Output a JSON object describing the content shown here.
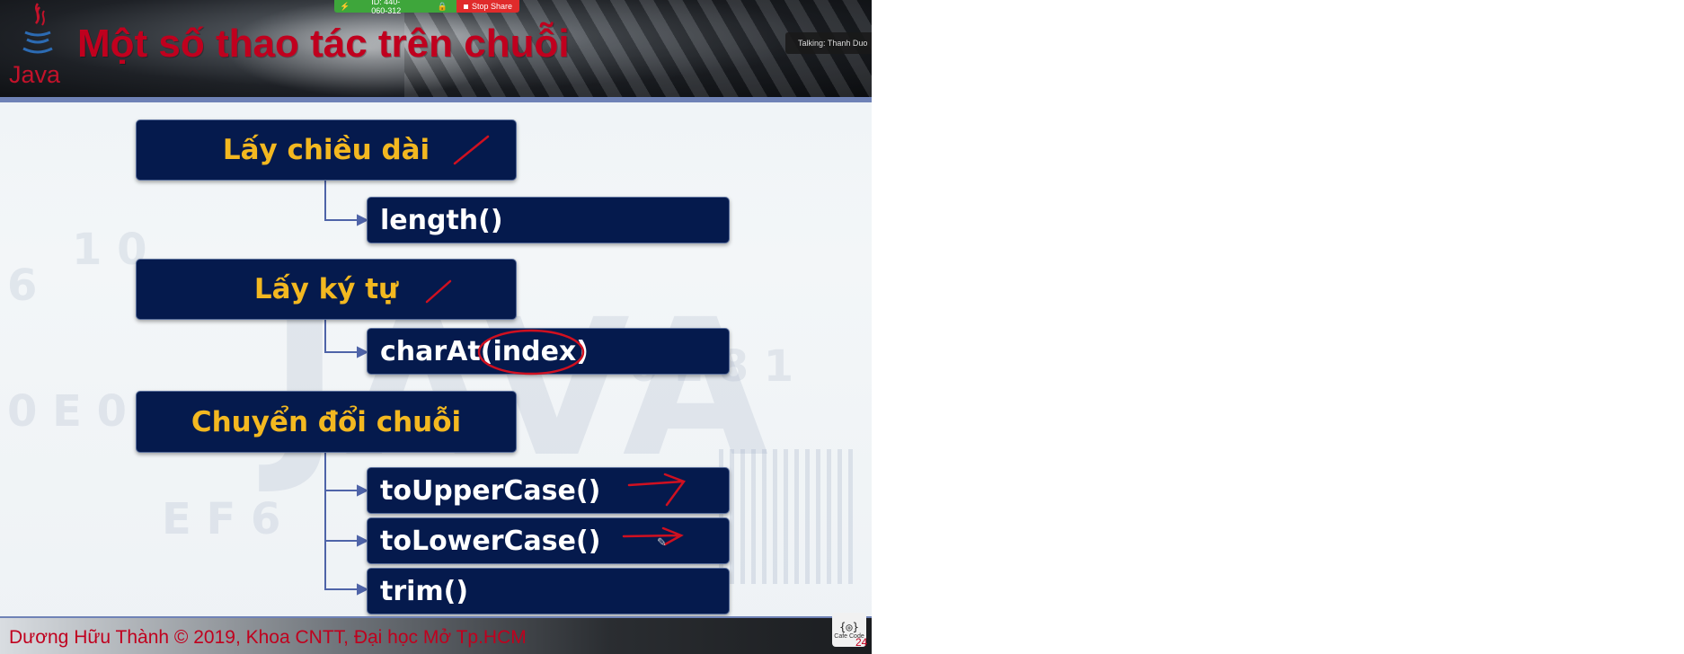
{
  "zoom_bar": {
    "meeting_id": "ID: 440-060-312",
    "stop_share": "Stop Share"
  },
  "talking_indicator": "Talking: Thanh Duo",
  "slide": {
    "logo_word": "Java",
    "title": "Một số thao tác trên chuỗi",
    "groups": [
      {
        "label": "Lấy chiều dài",
        "methods": [
          "length()"
        ]
      },
      {
        "label": "Lấy ký tự",
        "methods": [
          "charAt(index)"
        ]
      },
      {
        "label": "Chuyển đổi chuỗi",
        "methods": [
          "toUpperCase()",
          "toLowerCase()",
          "trim()"
        ]
      }
    ],
    "footer": "Dương Hữu Thành © 2019, Khoa CNTT, Đại học Mở Tp.HCM",
    "cafe_logo_text": "Cafe Code",
    "page_number": "24"
  },
  "colors": {
    "box_fill": "#051a4d",
    "category_text": "#f3b820",
    "method_text": "#ffffff",
    "title_red": "#c0001e",
    "annotation_red": "#d01020",
    "connector_blue": "#4f64a8"
  }
}
